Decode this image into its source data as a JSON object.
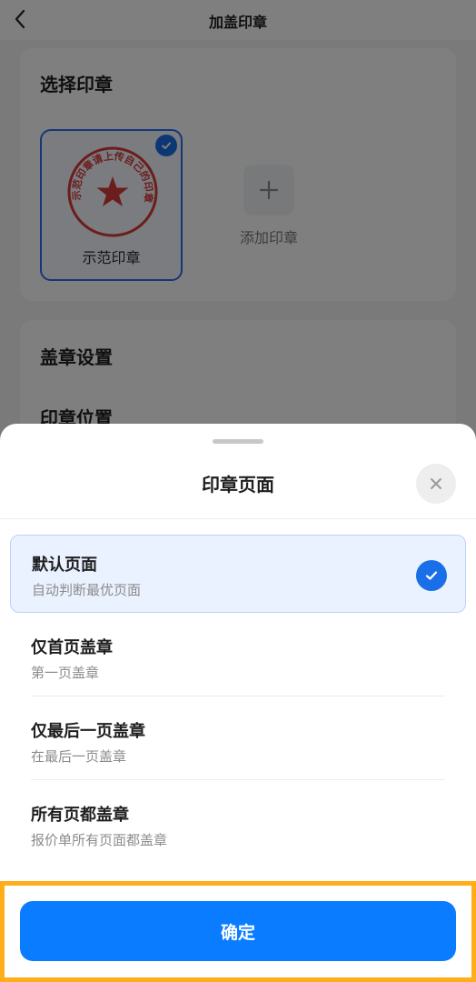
{
  "nav": {
    "title": "加盖印章",
    "back_icon": "chevron-left-icon"
  },
  "select_seal": {
    "title": "选择印章",
    "seals": [
      {
        "label": "示范印章",
        "stamp_text": "示范印章请上传自己的印章",
        "selected": true
      }
    ],
    "add_label": "添加印章"
  },
  "settings": {
    "title": "盖章设置",
    "position_label": "印章位置"
  },
  "sheet": {
    "title": "印章页面",
    "close_icon": "close-icon",
    "options": [
      {
        "title": "默认页面",
        "subtitle": "自动判断最优页面",
        "selected": true
      },
      {
        "title": "仅首页盖章",
        "subtitle": "第一页盖章",
        "selected": false
      },
      {
        "title": "仅最后一页盖章",
        "subtitle": "在最后一页盖章",
        "selected": false
      },
      {
        "title": "所有页都盖章",
        "subtitle": "报价单所有页面都盖章",
        "selected": false
      }
    ]
  },
  "footer": {
    "confirm_label": "确定"
  },
  "colors": {
    "primary": "#0a7cff",
    "check": "#1a6fe8",
    "stamp_red": "#d93a3a",
    "highlight": "#ffad18",
    "selected_bg": "#eaf1ff"
  }
}
